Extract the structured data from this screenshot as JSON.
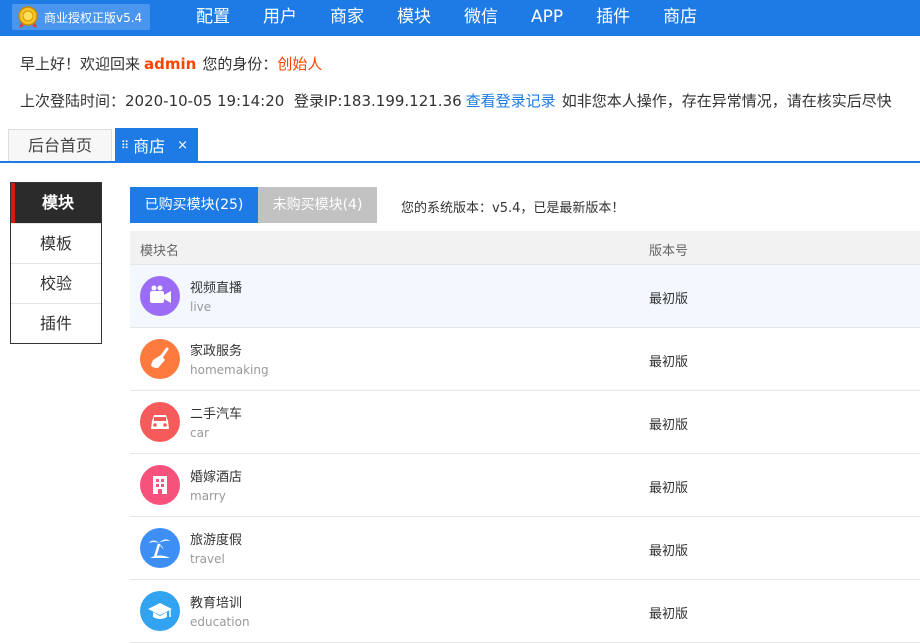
{
  "header": {
    "brand": "商业授权正版v5.4",
    "nav": [
      "配置",
      "用户",
      "商家",
      "模块",
      "微信",
      "APP",
      "插件",
      "商店"
    ]
  },
  "greeting": {
    "prefix": "早上好！欢迎回来",
    "username": "admin",
    "role_label": "您的身份：",
    "role": "创始人"
  },
  "login": {
    "time_text": "上次登陆时间：2020-10-05 19:14:20",
    "ip_text": "登录IP:183.199.121.36",
    "link": "查看登录记录",
    "warning": "如非您本人操作，存在异常情况，请在核实后尽快"
  },
  "tabs": {
    "home": "后台首页",
    "active": "商店",
    "close": "×"
  },
  "sidebar": {
    "items": [
      "模块",
      "模板",
      "校验",
      "插件"
    ]
  },
  "toolbar": {
    "bought": "已购买模块(25)",
    "unbought": "未购买模块(4)",
    "version_note": "您的系统版本：v5.4，已是最新版本！"
  },
  "table": {
    "headers": [
      "模块名",
      "版本号"
    ],
    "rows": [
      {
        "name": "视频直播",
        "code": "live",
        "version": "最初版",
        "icon": "video-camera-icon",
        "color": "#9b6cf5"
      },
      {
        "name": "家政服务",
        "code": "homemaking",
        "version": "最初版",
        "icon": "broom-icon",
        "color": "#ff7a3d"
      },
      {
        "name": "二手汽车",
        "code": "car",
        "version": "最初版",
        "icon": "car-icon",
        "color": "#f65b5b"
      },
      {
        "name": "婚嫁酒店",
        "code": "marry",
        "version": "最初版",
        "icon": "building-icon",
        "color": "#f7527c"
      },
      {
        "name": "旅游度假",
        "code": "travel",
        "version": "最初版",
        "icon": "palm-tree-icon",
        "color": "#3d8ff5"
      },
      {
        "name": "教育培训",
        "code": "education",
        "version": "最初版",
        "icon": "graduation-cap-icon",
        "color": "#32a3f0"
      }
    ]
  },
  "colors": {
    "primary": "#1e7be6",
    "accent": "#ff4400",
    "sidebar_active": "#2b2b2b"
  }
}
